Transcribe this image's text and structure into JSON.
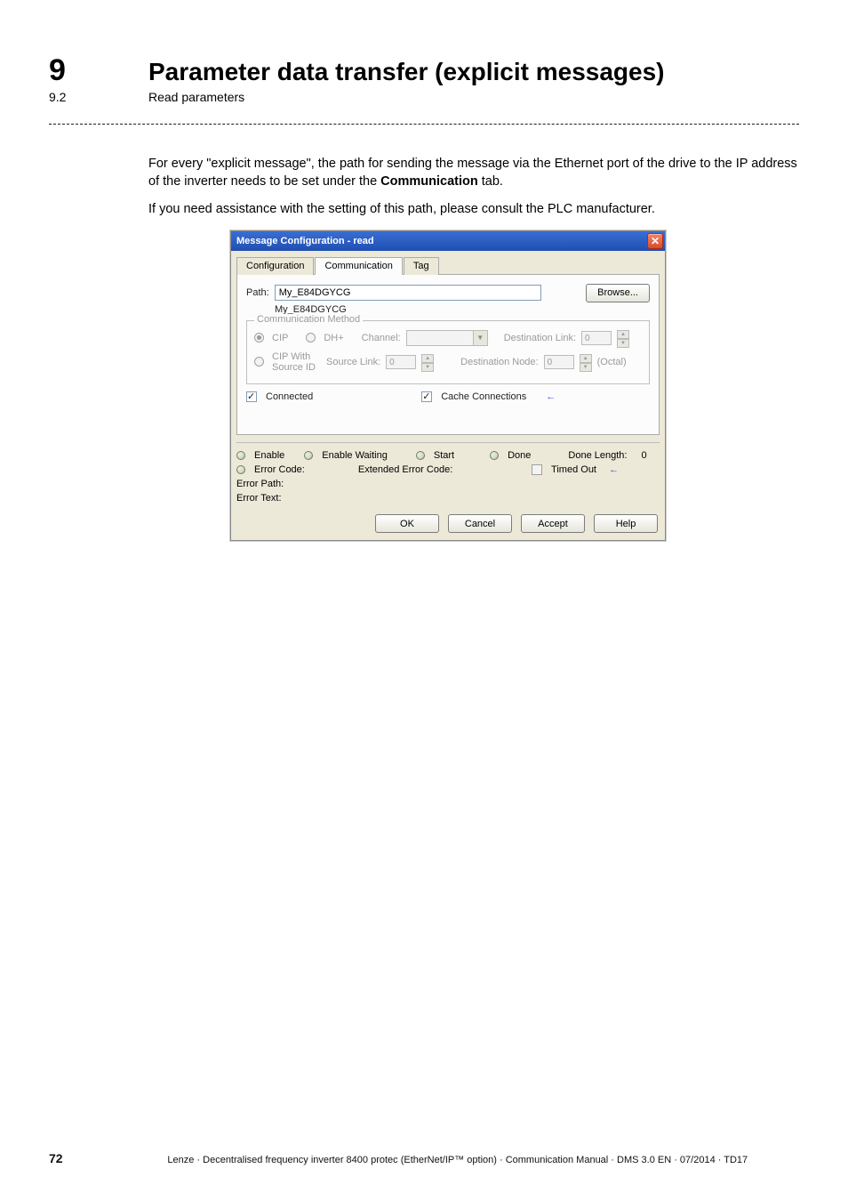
{
  "chapter": {
    "number": "9",
    "title": "Parameter data transfer (explicit messages)"
  },
  "subsection": {
    "number": "9.2",
    "title": "Read parameters"
  },
  "para1_a": "For every \"explicit message\", the path for sending the message via the Ethernet port of the drive to the IP address of the inverter needs to be set under the ",
  "para1_bold": "Communication",
  "para1_b": " tab.",
  "para2": "If you need assistance with the setting of this path, please consult the PLC manufacturer.",
  "dialog": {
    "title": "Message Configuration - read",
    "tabs": [
      "Configuration",
      "Communication",
      "Tag"
    ],
    "active_tab": 1,
    "path_label": "Path:",
    "path_value": "My_E84DGYCG",
    "path_sub": "My_E84DGYCG",
    "browse_button": "Browse...",
    "group_legend": "Communication Method",
    "radio_cip": "CIP",
    "radio_dhplus": "DH+",
    "channel_label": "Channel:",
    "radio_cip_with": "CIP With Source ID",
    "source_link_label": "Source Link:",
    "source_link_value": "0",
    "dest_link_label": "Destination Link:",
    "dest_link_value": "0",
    "dest_node_label": "Destination Node:",
    "dest_node_value": "0",
    "octal_label": "(Octal)",
    "connected_label": "Connected",
    "cache_label": "Cache Connections",
    "status": {
      "enable": "Enable",
      "enable_waiting": "Enable Waiting",
      "start": "Start",
      "done": "Done",
      "done_length": "Done Length:",
      "done_length_value": "0",
      "error_code": "Error Code:",
      "ext_error_code": "Extended Error Code:",
      "timed_out": "Timed Out",
      "error_path": "Error Path:",
      "error_text": "Error Text:"
    },
    "buttons": {
      "ok": "OK",
      "cancel": "Cancel",
      "accept": "Accept",
      "help": "Help"
    }
  },
  "footer": {
    "page_number": "72",
    "text": "Lenze · Decentralised frequency inverter 8400 protec (EtherNet/IP™ option) · Communication Manual · DMS 3.0 EN · 07/2014 · TD17"
  }
}
